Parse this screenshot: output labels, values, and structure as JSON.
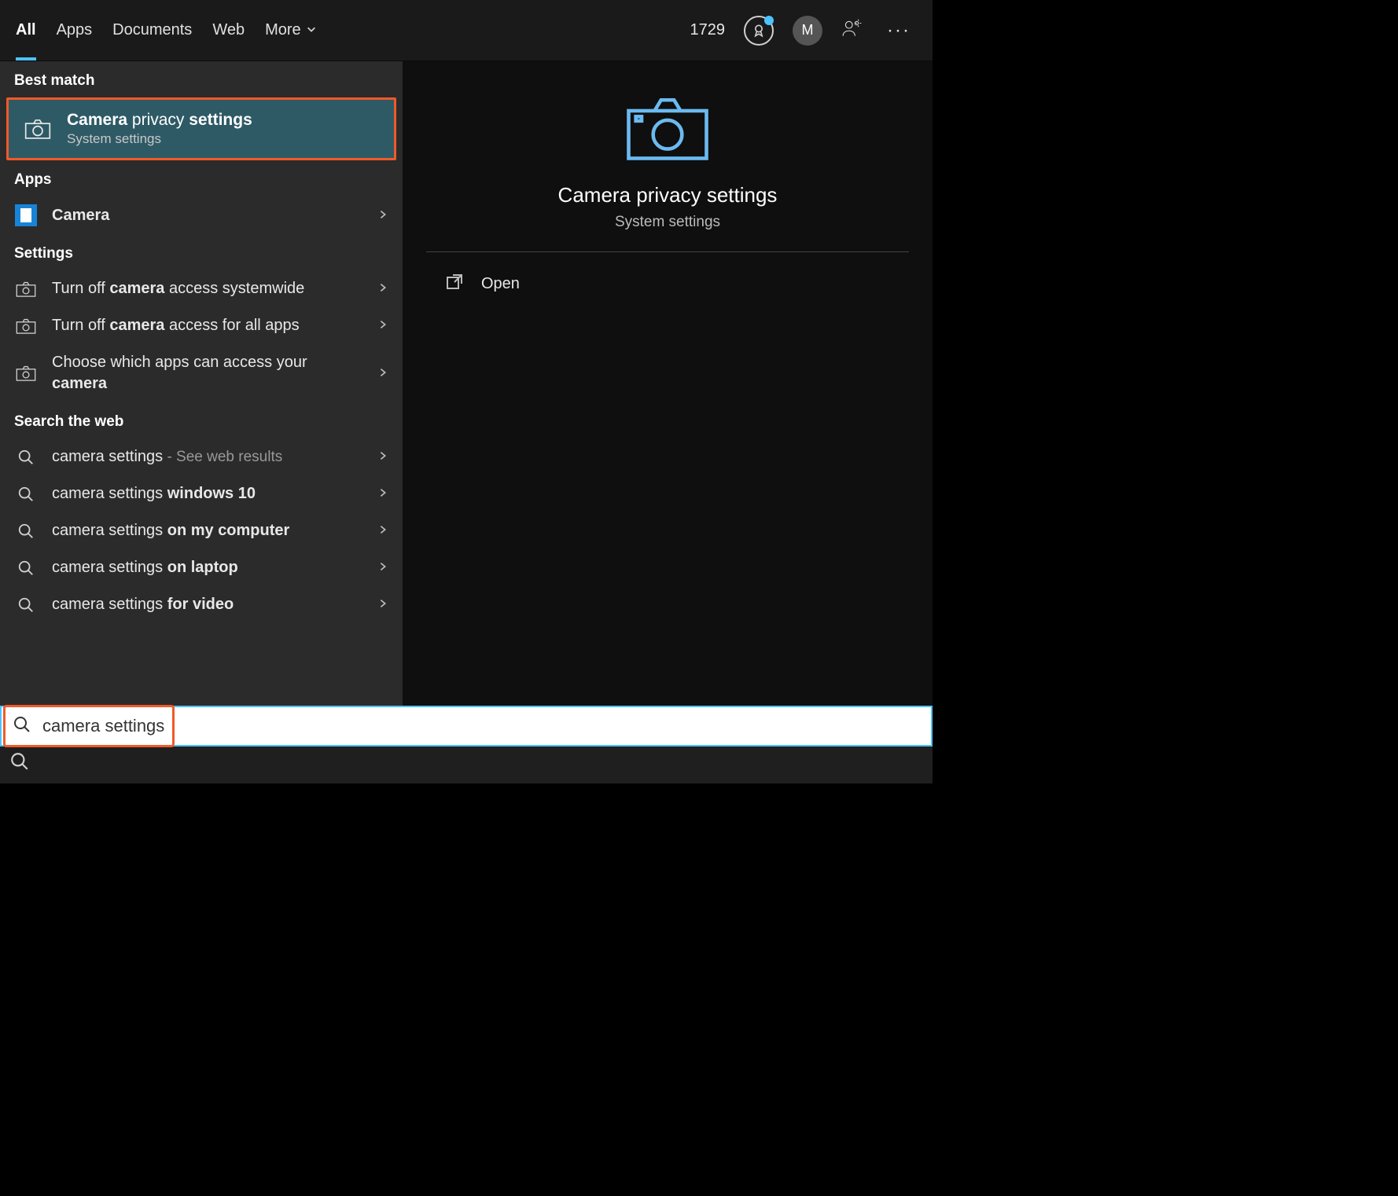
{
  "tabs": {
    "items": [
      "All",
      "Apps",
      "Documents",
      "Web",
      "More"
    ],
    "active_index": 0
  },
  "header": {
    "points": "1729",
    "avatar_initial": "M"
  },
  "left": {
    "best_match_label": "Best match",
    "best_match": {
      "title_parts": [
        "Camera",
        " privacy ",
        "settings"
      ],
      "subtitle": "System settings"
    },
    "apps_label": "Apps",
    "apps": [
      {
        "title_parts": [
          "Camera"
        ],
        "bold_mask": [
          true
        ]
      }
    ],
    "settings_label": "Settings",
    "settings": [
      {
        "pre": "Turn off ",
        "bold": "camera",
        "post": " access systemwide"
      },
      {
        "pre": "Turn off ",
        "bold": "camera",
        "post": " access for all apps"
      },
      {
        "pre": "Choose which apps can access your ",
        "bold": "camera",
        "post": ""
      }
    ],
    "web_label": "Search the web",
    "web": [
      {
        "pre": "camera settings",
        "bold": "",
        "hint": " - See web results"
      },
      {
        "pre": "camera settings ",
        "bold": "windows 10",
        "hint": ""
      },
      {
        "pre": "camera settings ",
        "bold": "on my computer",
        "hint": ""
      },
      {
        "pre": "camera settings ",
        "bold": "on laptop",
        "hint": ""
      },
      {
        "pre": "camera settings ",
        "bold": "for video",
        "hint": ""
      }
    ]
  },
  "right": {
    "title": "Camera privacy settings",
    "subtitle": "System settings",
    "open_label": "Open"
  },
  "search": {
    "value": "camera settings"
  }
}
